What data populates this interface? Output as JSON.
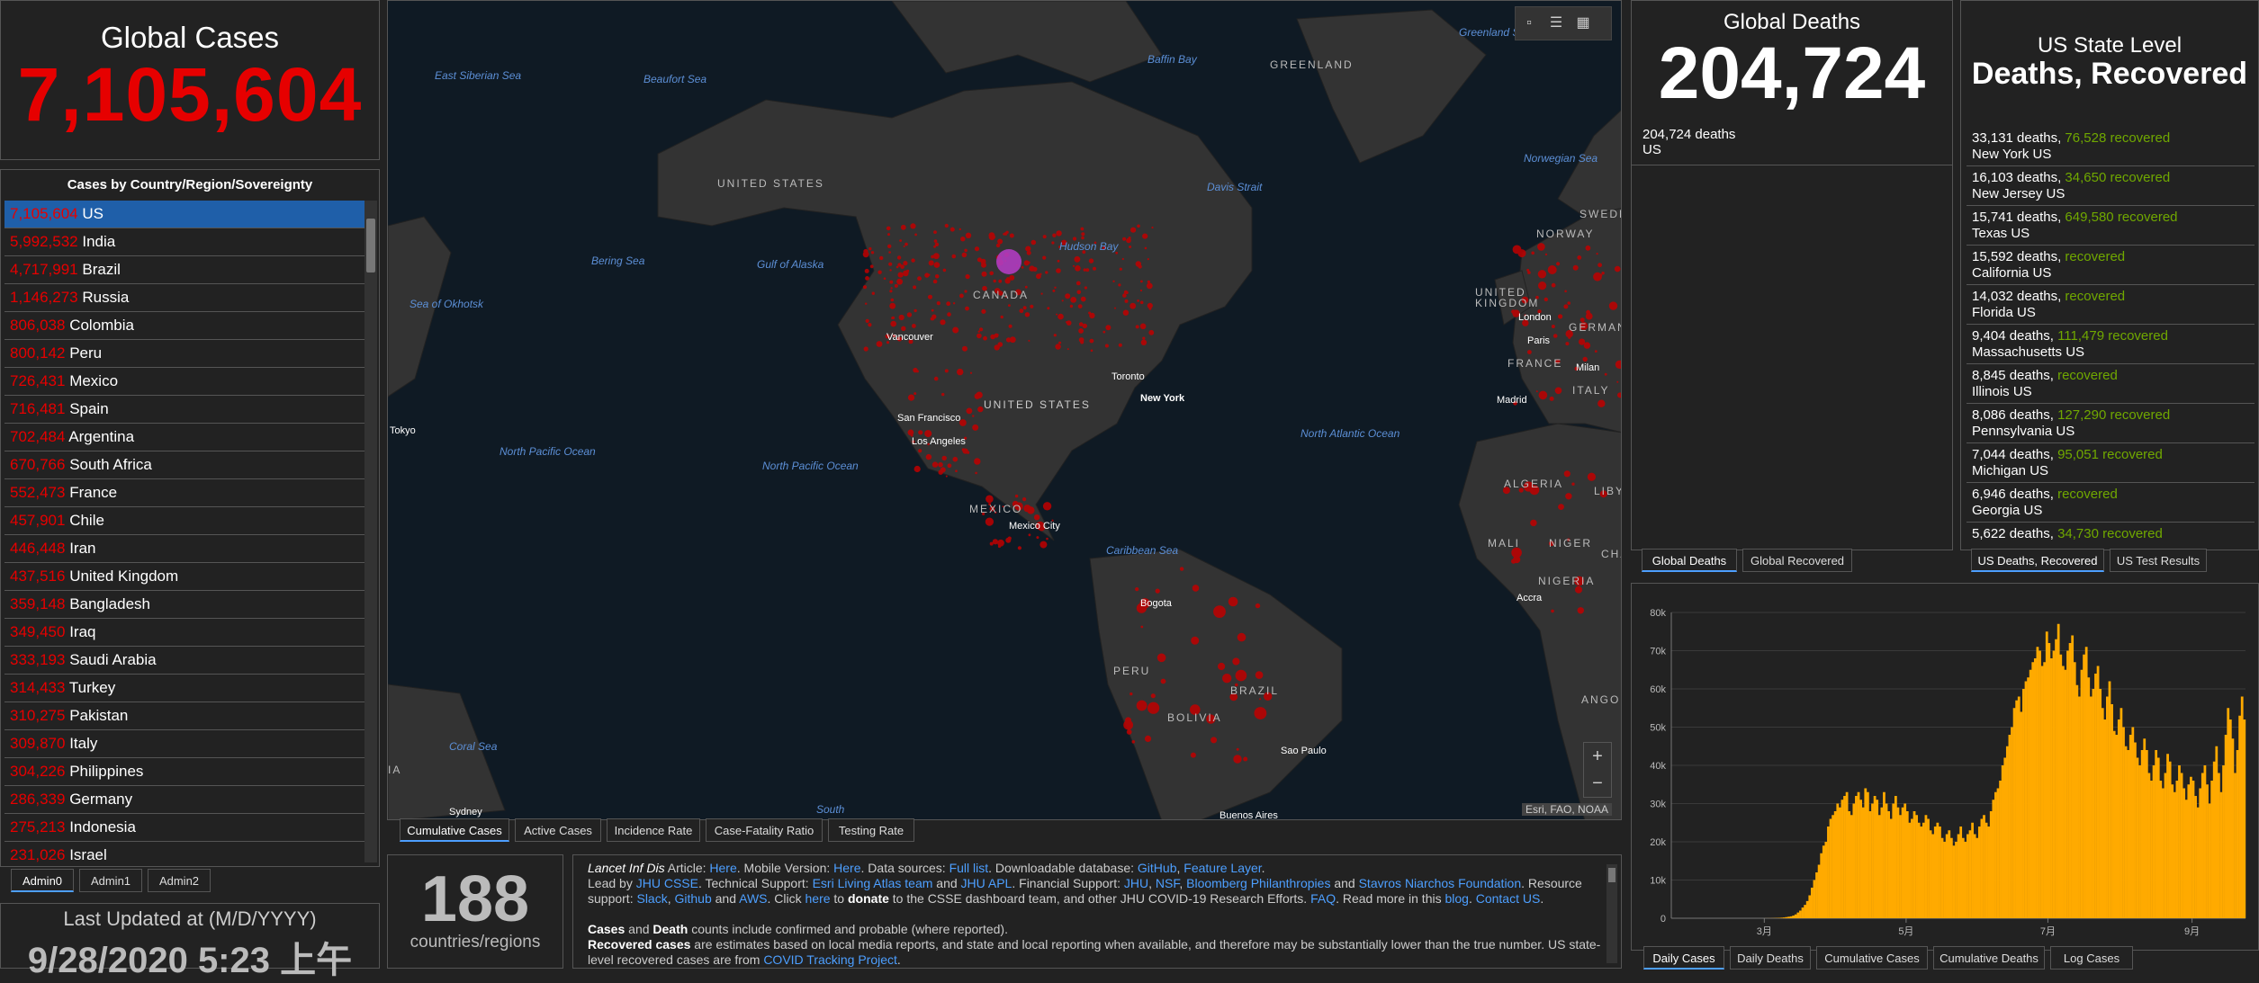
{
  "global_cases": {
    "title": "Global Cases",
    "value": "7,105,604"
  },
  "country_list": {
    "header": "Cases by Country/Region/Sovereignty",
    "items": [
      {
        "value": "7,105,604",
        "name": "US"
      },
      {
        "value": "5,992,532",
        "name": "India"
      },
      {
        "value": "4,717,991",
        "name": "Brazil"
      },
      {
        "value": "1,146,273",
        "name": "Russia"
      },
      {
        "value": "806,038",
        "name": "Colombia"
      },
      {
        "value": "800,142",
        "name": "Peru"
      },
      {
        "value": "726,431",
        "name": "Mexico"
      },
      {
        "value": "716,481",
        "name": "Spain"
      },
      {
        "value": "702,484",
        "name": "Argentina"
      },
      {
        "value": "670,766",
        "name": "South Africa"
      },
      {
        "value": "552,473",
        "name": "France"
      },
      {
        "value": "457,901",
        "name": "Chile"
      },
      {
        "value": "446,448",
        "name": "Iran"
      },
      {
        "value": "437,516",
        "name": "United Kingdom"
      },
      {
        "value": "359,148",
        "name": "Bangladesh"
      },
      {
        "value": "349,450",
        "name": "Iraq"
      },
      {
        "value": "333,193",
        "name": "Saudi Arabia"
      },
      {
        "value": "314,433",
        "name": "Turkey"
      },
      {
        "value": "310,275",
        "name": "Pakistan"
      },
      {
        "value": "309,870",
        "name": "Italy"
      },
      {
        "value": "304,226",
        "name": "Philippines"
      },
      {
        "value": "286,339",
        "name": "Germany"
      },
      {
        "value": "275,213",
        "name": "Indonesia"
      },
      {
        "value": "231,026",
        "name": "Israel"
      }
    ],
    "tabs": [
      "Admin0",
      "Admin1",
      "Admin2"
    ]
  },
  "last_updated": {
    "title": "Last Updated at (M/D/YYYY)",
    "value": "9/28/2020 5:23 上午"
  },
  "map": {
    "ocean_labels": [
      "East Siberian Sea",
      "Beaufort Sea",
      "Baffin Bay",
      "Greenland Sea",
      "Norwegian Sea",
      "Davis Strait",
      "Hudson Bay",
      "Gulf of Alaska",
      "Bering Sea",
      "Sea of Okhotsk",
      "North Pacific Ocean",
      "North Pacific Ocean",
      "North Atlantic Ocean",
      "Caribbean Sea",
      "Coral Sea",
      "South"
    ],
    "country_labels": [
      "GREENLAND",
      "UNITED STATES",
      "CANADA",
      "UNITED STATES",
      "MEXICO",
      "BRAZIL",
      "PERU",
      "BOLIVIA",
      "ALGERIA",
      "MALI",
      "NIGER",
      "NIGERIA",
      "NORWAY",
      "SWEDEN",
      "UNITED KINGDOM",
      "FRANCE",
      "GERMANY",
      "ITALY",
      "LIBY",
      "CHA",
      "ANGOL",
      "IA"
    ],
    "cities": [
      "Vancouver",
      "Toronto",
      "New York",
      "San Francisco",
      "Los Angeles",
      "Mexico City",
      "Bogota",
      "Sao Paulo",
      "Buenos Aires",
      "Tokyo",
      "Sydney",
      "London",
      "Paris",
      "Madrid",
      "Milan",
      "Accra"
    ],
    "attribution": "Esri, FAO, NOAA",
    "tabs": [
      "Cumulative Cases",
      "Active Cases",
      "Incidence Rate",
      "Case-Fatality Ratio",
      "Testing Rate"
    ]
  },
  "countries": {
    "value": "188",
    "label": "countries/regions"
  },
  "info": {
    "l1a": "Lancet Inf Dis",
    "l1b": " Article: ",
    "l1c": "Here",
    "l1d": ". Mobile Version: ",
    "l1e": "Here",
    "l1f": ". Data sources: ",
    "l1g": "Full list",
    "l1h": ". Downloadable database: ",
    "l1i": "GitHub",
    "l1j": ", ",
    "l1k": "Feature Layer",
    "l1l": ".",
    "l2a": "Lead by ",
    "l2b": "JHU CSSE",
    "l2c": ". Technical Support: ",
    "l2d": "Esri Living Atlas team",
    "l2e": " and ",
    "l2f": "JHU APL",
    "l2g": ". Financial Support: ",
    "l2h": "JHU",
    "l2i": ", ",
    "l2j": "NSF",
    "l2k": ", ",
    "l2l": "Bloomberg Philanthropies",
    "l2m": " and ",
    "l2n": "Stavros Niarchos Foundation",
    "l2o": ". Resource support: ",
    "l2p": "Slack",
    "l2q": ", ",
    "l2r": "Github",
    "l2s": " and ",
    "l2t": "AWS",
    "l2u": ". Click ",
    "l2v": "here",
    "l2w": " to ",
    "l2x": "donate",
    "l2y": " to the CSSE dashboard team, and other JHU COVID-19 Research Efforts. ",
    "l2z": "FAQ",
    "l2aa": ". Read more in this ",
    "l2ab": "blog",
    "l2ac": ". ",
    "l2ad": "Contact US",
    "l2ae": ".",
    "l3a": "Cases",
    "l3b": " and ",
    "l3c": "Death",
    "l3d": " counts include confirmed and probable (where reported).",
    "l4a": "Recovered cases",
    "l4b": " are estimates based on local media reports, and state and local reporting when available, and therefore may be substantially lower than the true number. US state-level recovered cases are from ",
    "l4c": "COVID Tracking Project",
    "l4d": "."
  },
  "global_deaths": {
    "title": "Global Deaths",
    "value": "204,724",
    "row_value": "204,724 deaths",
    "row_name": "US",
    "tabs": [
      "Global Deaths",
      "Global Recovered"
    ]
  },
  "us_state": {
    "title1": "US State Level",
    "title2": "Deaths, Recovered",
    "items": [
      {
        "deaths": "33,131 deaths, ",
        "recovered": "76,528",
        "rl": " recovered",
        "state": "New York US"
      },
      {
        "deaths": "16,103 deaths, ",
        "recovered": "34,650",
        "rl": " recovered",
        "state": "New Jersey US"
      },
      {
        "deaths": "15,741 deaths, ",
        "recovered": "649,580",
        "rl": " recovered",
        "state": "Texas US"
      },
      {
        "deaths": "15,592 deaths, ",
        "recovered": "",
        "rl": " recovered",
        "state": "California US"
      },
      {
        "deaths": "14,032 deaths, ",
        "recovered": "",
        "rl": " recovered",
        "state": "Florida US"
      },
      {
        "deaths": "9,404 deaths, ",
        "recovered": "111,479",
        "rl": " recovered",
        "state": "Massachusetts US"
      },
      {
        "deaths": "8,845 deaths, ",
        "recovered": "",
        "rl": " recovered",
        "state": "Illinois US"
      },
      {
        "deaths": "8,086 deaths, ",
        "recovered": "127,290",
        "rl": " recovered",
        "state": "Pennsylvania US"
      },
      {
        "deaths": "7,044 deaths, ",
        "recovered": "95,051",
        "rl": " recovered",
        "state": "Michigan US"
      },
      {
        "deaths": "6,946 deaths, ",
        "recovered": "",
        "rl": " recovered",
        "state": "Georgia US"
      },
      {
        "deaths": "5,622 deaths, ",
        "recovered": "34,730",
        "rl": " recovered",
        "state": ""
      }
    ],
    "tabs": [
      "US Deaths, Recovered",
      "US Test Results"
    ]
  },
  "chart_tabs": [
    "Daily Cases",
    "Daily Deaths",
    "Cumulative Cases",
    "Cumulative Deaths",
    "Log Cases"
  ],
  "colors": {
    "cases_red": "#e60000",
    "recovered_green": "#70a800",
    "bar_orange": "#ffaa00",
    "selected_blue": "#1f5fa9",
    "link_blue": "#4d9fff"
  },
  "chart_data": {
    "type": "bar",
    "title": "",
    "xlabel": "",
    "ylabel": "",
    "ylim": [
      0,
      80000
    ],
    "yticks": [
      "0",
      "10k",
      "20k",
      "30k",
      "40k",
      "50k",
      "60k",
      "70k",
      "80k"
    ],
    "xticks": [
      "3月",
      "5月",
      "7月",
      "9月"
    ],
    "xtick_days": [
      40,
      101,
      162,
      224
    ],
    "series": [
      {
        "name": "",
        "values": [
          0,
          0,
          0,
          0,
          0,
          0,
          0,
          0,
          0,
          0,
          0,
          0,
          0,
          0,
          0,
          0,
          0,
          0,
          0,
          0,
          0,
          0,
          0,
          0,
          0,
          0,
          0,
          0,
          0,
          0,
          0,
          0,
          0,
          0,
          0,
          0,
          0,
          0,
          0,
          0,
          10,
          15,
          20,
          30,
          50,
          70,
          100,
          150,
          200,
          300,
          400,
          500,
          700,
          1000,
          1500,
          2000,
          2800,
          3500,
          4500,
          6000,
          8000,
          10000,
          12000,
          14000,
          17000,
          19000,
          20000,
          24000,
          26000,
          27000,
          28000,
          30000,
          29000,
          31000,
          32000,
          33000,
          28000,
          27000,
          30000,
          32000,
          33000,
          31000,
          29000,
          34000,
          33000,
          28000,
          30000,
          32000,
          31000,
          27000,
          29000,
          33000,
          30000,
          28000,
          26000,
          30000,
          32000,
          29000,
          27000,
          29000,
          30000,
          28000,
          25000,
          26000,
          28000,
          27000,
          25000,
          24000,
          25000,
          27000,
          26000,
          23000,
          22000,
          24000,
          25000,
          24000,
          21000,
          20000,
          22000,
          23000,
          21000,
          19000,
          20000,
          22000,
          24000,
          21000,
          20000,
          22000,
          23000,
          25000,
          22000,
          21000,
          24000,
          26000,
          27000,
          25000,
          24000,
          28000,
          31000,
          33000,
          34000,
          36000,
          40000,
          42000,
          45000,
          48000,
          50000,
          55000,
          57000,
          58000,
          54000,
          60000,
          62000,
          63000,
          65000,
          67000,
          68000,
          71000,
          70000,
          66000,
          67000,
          75000,
          72000,
          68000,
          70000,
          73000,
          77000,
          69000,
          66000,
          65000,
          70000,
          72000,
          74000,
          67000,
          61000,
          58000,
          65000,
          69000,
          71000,
          63000,
          58000,
          60000,
          64000,
          66000,
          60000,
          55000,
          52000,
          58000,
          62000,
          56000,
          49000,
          48000,
          52000,
          55000,
          50000,
          45000,
          44000,
          48000,
          50000,
          46000,
          42000,
          40000,
          44000,
          47000,
          44000,
          38000,
          36000,
          40000,
          44000,
          42000,
          36000,
          34000,
          38000,
          43000,
          41000,
          35000,
          33000,
          36000,
          40000,
          38000,
          34000,
          31000,
          35000,
          37000,
          36000,
          32000,
          29000,
          34000,
          38000,
          40000,
          35000,
          30000,
          36000,
          41000,
          45000,
          38000,
          33000,
          40000,
          48000,
          55000,
          52000,
          47000,
          38000,
          44000,
          53000,
          58000,
          52000
        ]
      }
    ]
  }
}
